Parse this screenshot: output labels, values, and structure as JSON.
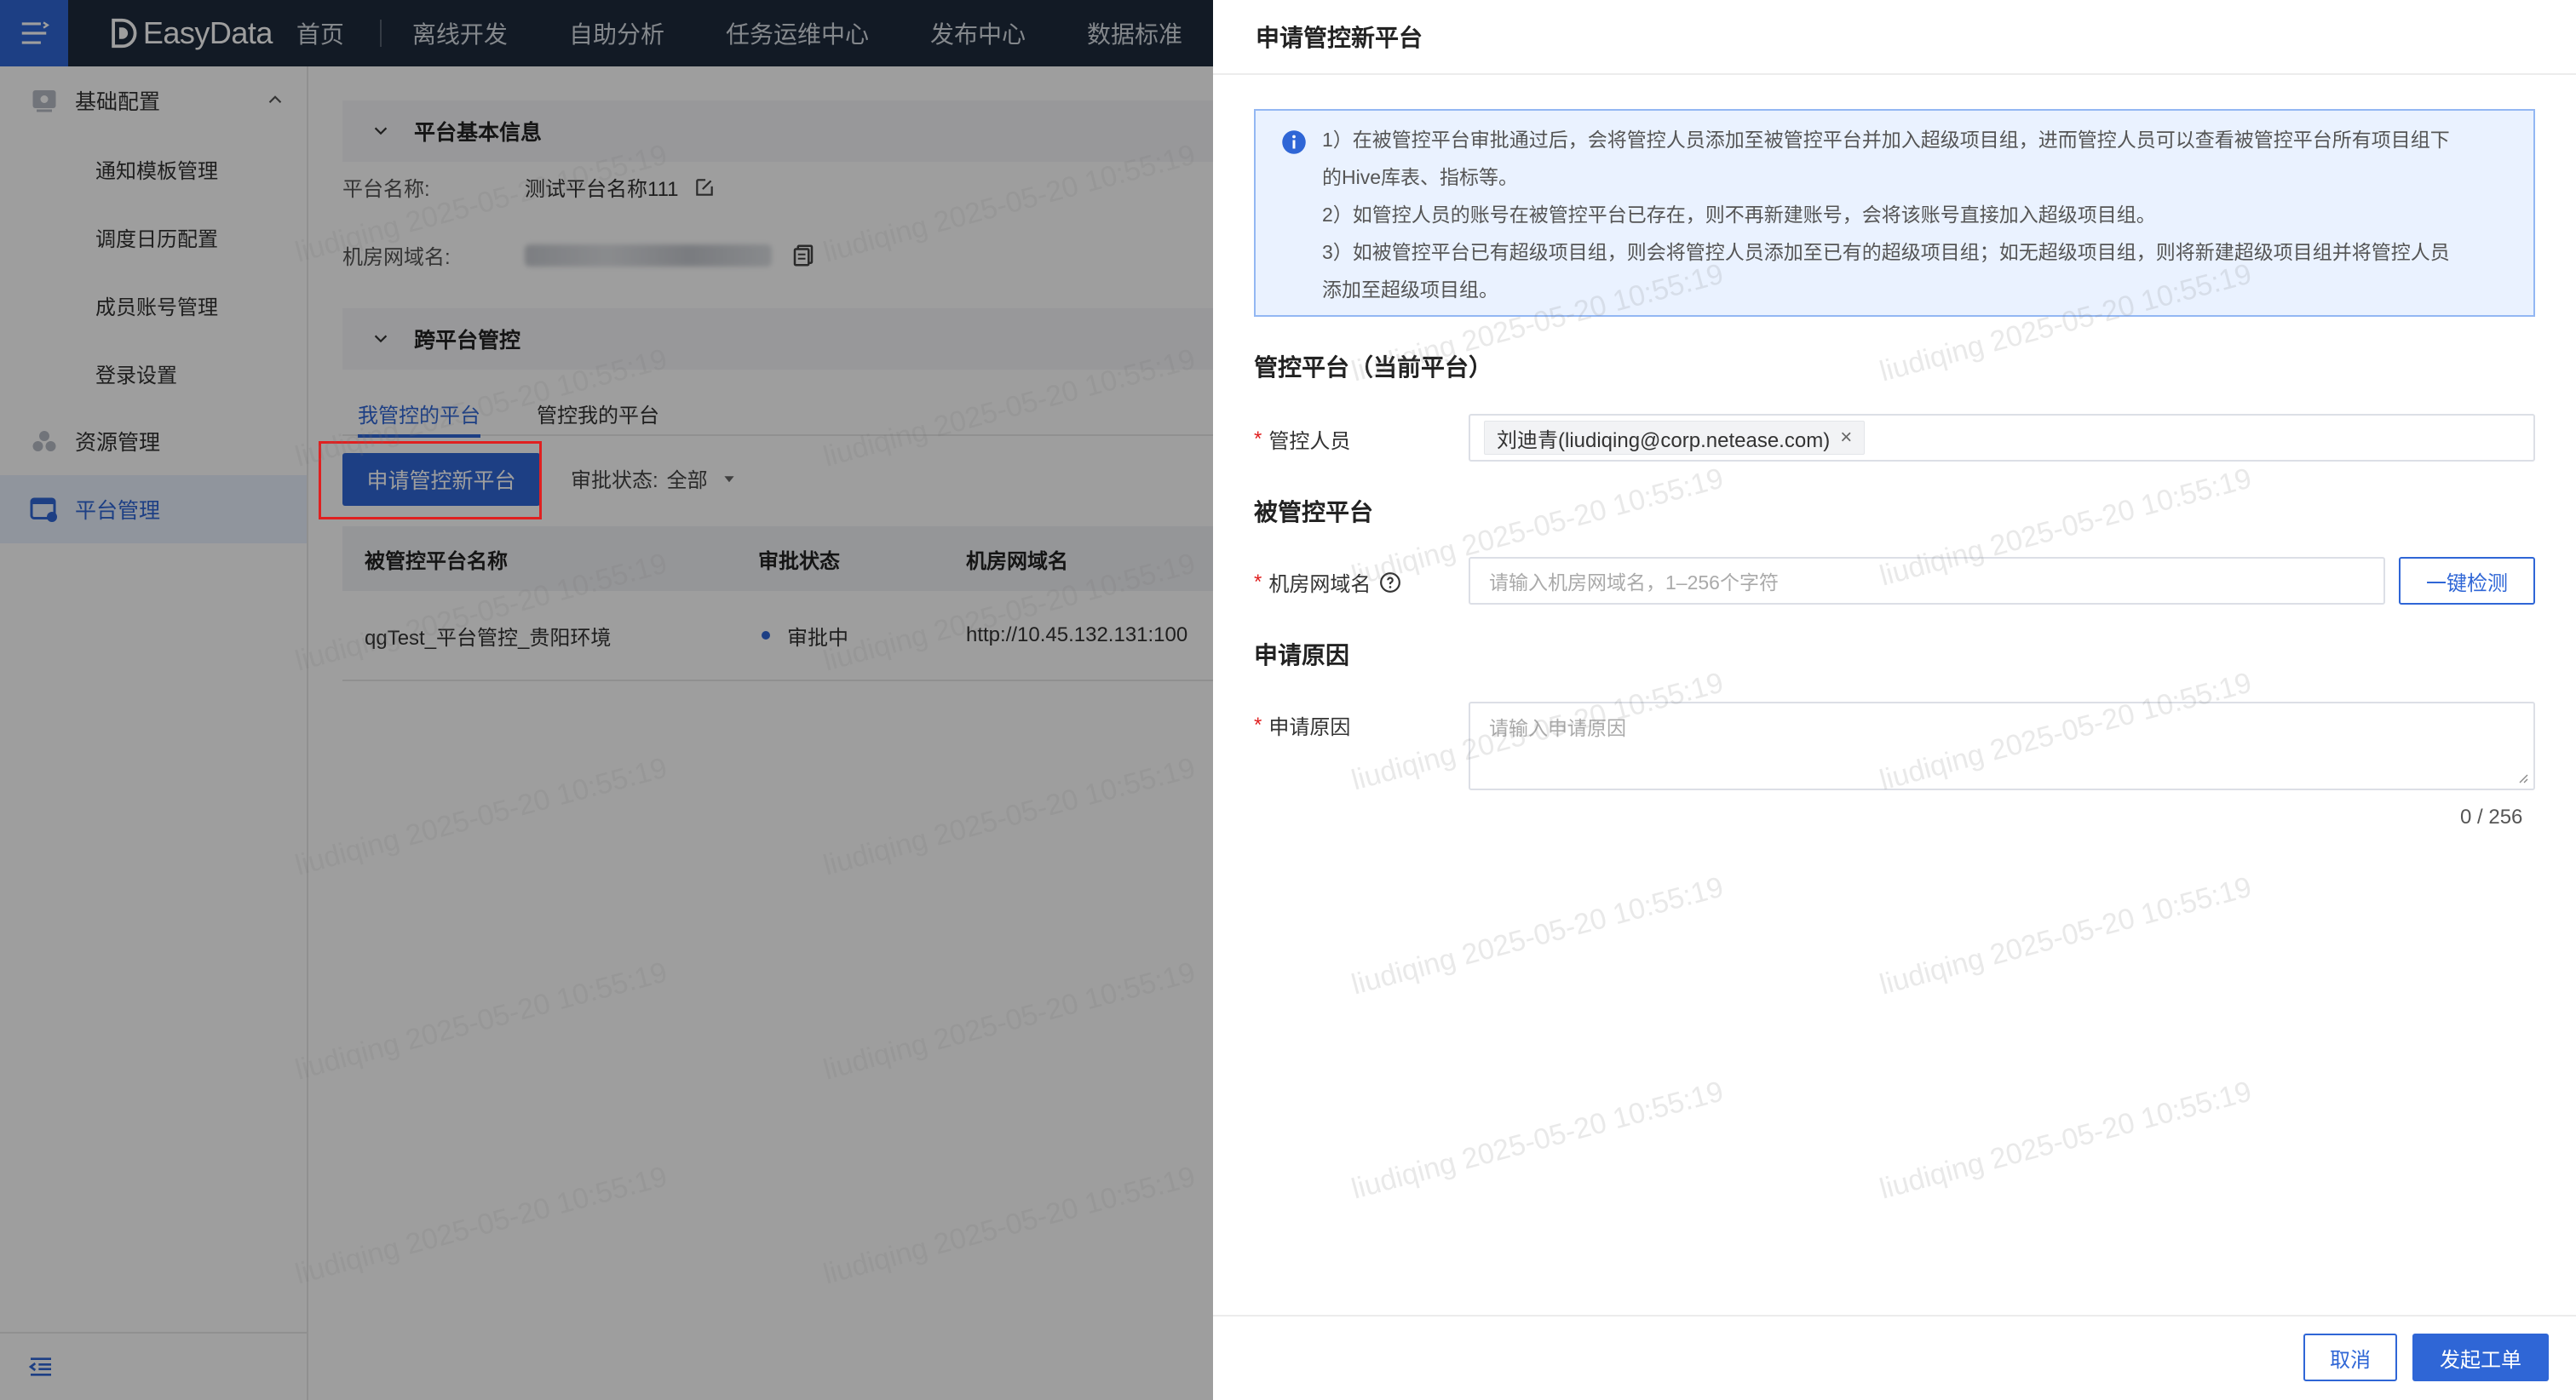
{
  "app": {
    "logo_text": "EasyData",
    "brand_color": "#2f66d6",
    "nav": [
      "首页",
      "离线开发",
      "自助分析",
      "任务运维中心",
      "发布中心",
      "数据标准"
    ]
  },
  "sidebar": {
    "group_basic": "基础配置",
    "subitems": [
      "通知模板管理",
      "调度日历配置",
      "成员账号管理",
      "登录设置"
    ],
    "group_resource": "资源管理",
    "group_platform": "平台管理"
  },
  "main": {
    "section_basic": "平台基本信息",
    "platform_name_label": "平台名称:",
    "platform_name_value": "测试平台名称111",
    "domain_label": "机房网域名:",
    "section_cross": "跨平台管控",
    "tabs": [
      "我管控的平台",
      "管控我的平台"
    ],
    "apply_button": "申请管控新平台",
    "filter_label": "审批状态:",
    "filter_value": "全部",
    "table": {
      "headers": [
        "被管控平台名称",
        "审批状态",
        "机房网域名"
      ],
      "rows": [
        {
          "name": "qgTest_平台管控_贵阳环境",
          "status": "审批中",
          "domain": "http://10.45.132.131:100"
        }
      ]
    }
  },
  "drawer": {
    "title": "申请管控新平台",
    "info_lines": [
      "1）在被管控平台审批通过后，会将管控人员添加至被管控平台并加入超级项目组，进而管控人员可以查看被管控平台所有项目组下",
      "的Hive库表、指标等。",
      "2）如管控人员的账号在被管控平台已存在，则不再新建账号，会将该账号直接加入超级项目组。",
      "3）如被管控平台已有超级项目组，则会将管控人员添加至已有的超级项目组；如无超级项目组，则将新建超级项目组并将管控人员",
      "添加至超级项目组。"
    ],
    "section_current": "管控平台（当前平台）",
    "manager_label": "管控人员",
    "manager_tag": "刘迪青(liudiqing@corp.netease.com)",
    "section_target": "被管控平台",
    "domain_label": "机房网域名",
    "domain_placeholder": "请输入机房网域名，1–256个字符",
    "check_button": "一键检测",
    "section_reason": "申请原因",
    "reason_label": "申请原因",
    "reason_placeholder": "请输入申请原因",
    "counter": "0 / 256",
    "cancel_button": "取消",
    "submit_button": "发起工单"
  },
  "watermark": "liudiqing 2025-05-20 10:55:19"
}
